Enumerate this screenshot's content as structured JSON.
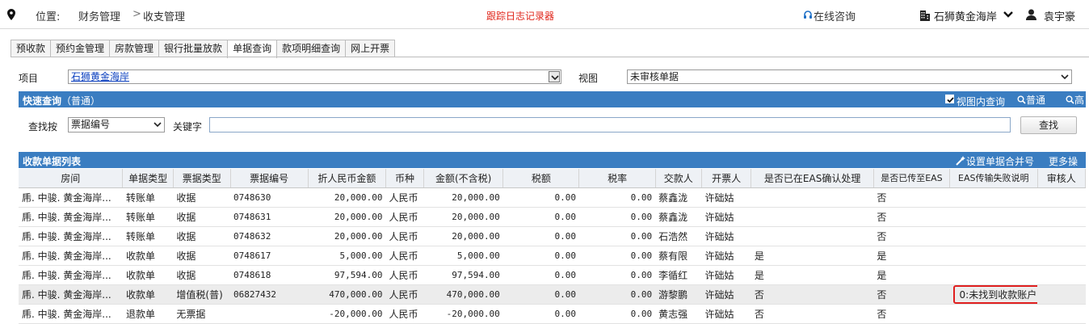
{
  "topbar": {
    "location_label": "位置:",
    "crumb1": "财务管理",
    "separator": ">",
    "crumb2": "收支管理",
    "tracker": "跟踪日志记录器",
    "consult": "在线咨询",
    "project": "石狮黄金海岸",
    "user": "袁宇豪"
  },
  "tabs": [
    "预收款",
    "预约金管理",
    "房款管理",
    "银行批量放款",
    "单据查询",
    "款项明细查询",
    "网上开票"
  ],
  "active_tab": 4,
  "filter": {
    "project_label": "项目",
    "project_value": "石狮黄金海岸",
    "view_label": "视图",
    "view_value": "未审核单据"
  },
  "quick_query": {
    "title": "快速查询",
    "mode": "（普通）",
    "in_view_label": "视图内查询",
    "in_view_checked": true,
    "normal": "普通",
    "advanced": "高级",
    "find_by_label": "查找按",
    "find_by_value": "票据编号",
    "keyword_label": "关键字",
    "keyword_value": "",
    "search_button": "查找"
  },
  "grid": {
    "title": "收款单据列表",
    "merge_action": "设置单据合并号",
    "more_action": "更多操作",
    "columns": [
      "房间",
      "单据类型",
      "票据类型",
      "票据编号",
      "折人民币金额",
      "币种",
      "金额(不含税)",
      "税额",
      "税率",
      "交款人",
      "开票人",
      "是否已在EAS确认处理",
      "是否已传至EAS",
      "EAS传输失败说明",
      "审核人"
    ],
    "rows": [
      [
        "乕. 中骏. 黄金海岸...",
        "转账单",
        "收据",
        "0748630",
        "20,000.00",
        "人民币",
        "20,000.00",
        "0.00",
        "0.00",
        "蔡鑫泷",
        "许础姑",
        "",
        "否",
        "",
        ""
      ],
      [
        "乕. 中骏. 黄金海岸...",
        "转账单",
        "收据",
        "0748631",
        "20,000.00",
        "人民币",
        "20,000.00",
        "0.00",
        "0.00",
        "蔡鑫泷",
        "许础姑",
        "",
        "否",
        "",
        ""
      ],
      [
        "乕. 中骏. 黄金海岸...",
        "转账单",
        "收据",
        "0748632",
        "20,000.00",
        "人民币",
        "20,000.00",
        "0.00",
        "0.00",
        "石浩然",
        "许础姑",
        "",
        "否",
        "",
        ""
      ],
      [
        "乕. 中骏. 黄金海岸...",
        "收款单",
        "收据",
        "0748617",
        "5,000.00",
        "人民币",
        "5,000.00",
        "0.00",
        "0.00",
        "蔡有限",
        "许础姑",
        "是",
        "是",
        "",
        ""
      ],
      [
        "乕. 中骏. 黄金海岸...",
        "收款单",
        "收据",
        "0748618",
        "97,594.00",
        "人民币",
        "97,594.00",
        "0.00",
        "0.00",
        "李循红",
        "许础姑",
        "是",
        "是",
        "",
        ""
      ],
      [
        "乕. 中骏. 黄金海岸...",
        "收款单",
        "增值税(普)",
        "06827432",
        "470,000.00",
        "人民币",
        "470,000.00",
        "0.00",
        "0.00",
        "游黎鹏",
        "许础姑",
        "否",
        "否",
        "0:未找到收款账户",
        ""
      ],
      [
        "乕. 中骏. 黄金海岸...",
        "退款单",
        "无票据",
        "",
        "-20,000.00",
        "人民币",
        "-20,000.00",
        "0.00",
        "0.00",
        "黄志强",
        "许础姑",
        "否",
        "否",
        "",
        ""
      ]
    ],
    "highlight_row": 5
  },
  "colors": {
    "header_blue": "#3a7dc1",
    "tracker_red": "#e0261b",
    "error_border": "#e02020"
  }
}
